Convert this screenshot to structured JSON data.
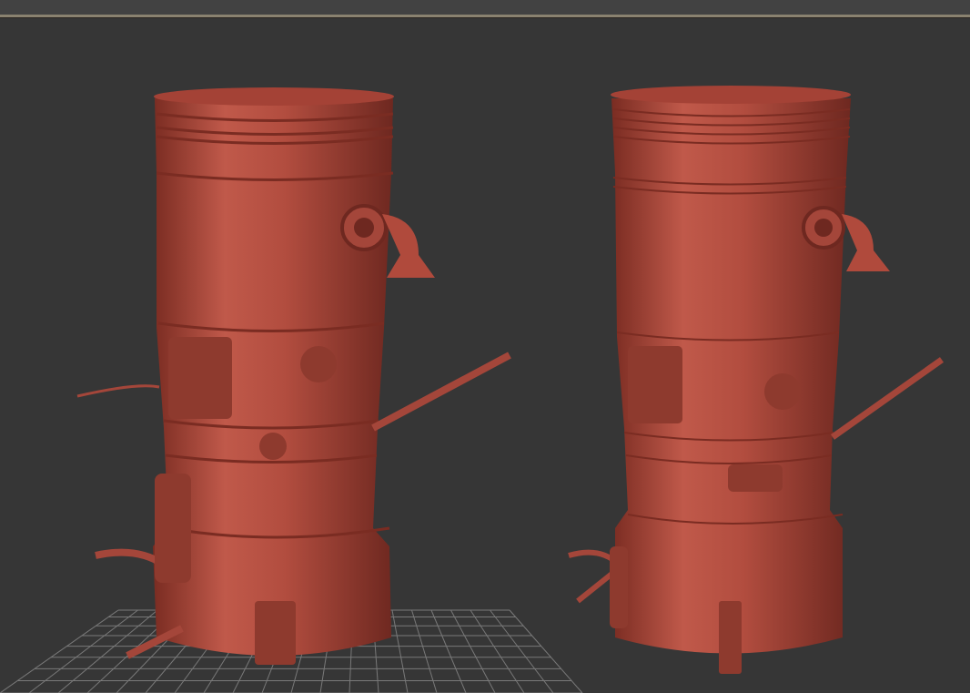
{
  "viewport": {
    "background_color": "#363636",
    "accent_line_color": "#8a8270",
    "model_color": "#b04a3c",
    "grid_color": "#8a8a8a",
    "models": [
      {
        "name": "engine-model-left"
      },
      {
        "name": "engine-model-right"
      }
    ]
  }
}
